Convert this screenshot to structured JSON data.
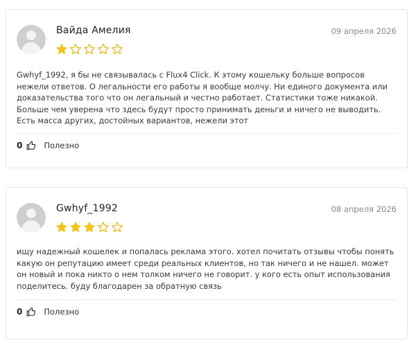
{
  "reviews": [
    {
      "author": "Вайда Амелия",
      "date": "09 апреля 2026",
      "rating": 1,
      "max_rating": 5,
      "text": "Gwhyf_1992, я бы не связывалась с Flux4 Click. К этому кошельку больше вопросов нежели ответов. О легальности его работы я вообще молчу. Ни единого документа или доказательства того что он легальный и честно работает. Статистики тоже никакой. Больше чем уверена что здесь будут просто принимать деньги и ничего не выводить. Есть масса других, достойных вариантов, нежели этот",
      "likes": "0",
      "like_label": "Полезно"
    },
    {
      "author": "Gwhyf_1992",
      "date": "08 апреля 2026",
      "rating": 3,
      "max_rating": 5,
      "text": "ищу надежный кошелек и попалась реклама этого. хотел почитать отзывы чтобы понять какую он репутацию имеет среди реальных клиентов, но так ничего и не нашел. может он новый и пока никто о нем толком ничего не говорит. у кого есть опыт использования поделитесь. буду благодарен за обратную связь",
      "likes": "0",
      "like_label": "Полезно"
    }
  ],
  "colors": {
    "star_filled": "#f2c31a",
    "star_empty_stroke": "#e6b400",
    "avatar_bg": "#cfcfcf"
  },
  "icons": {
    "avatar": "user-avatar-placeholder-icon",
    "star": "star-icon",
    "like": "thumbs-up-icon"
  }
}
